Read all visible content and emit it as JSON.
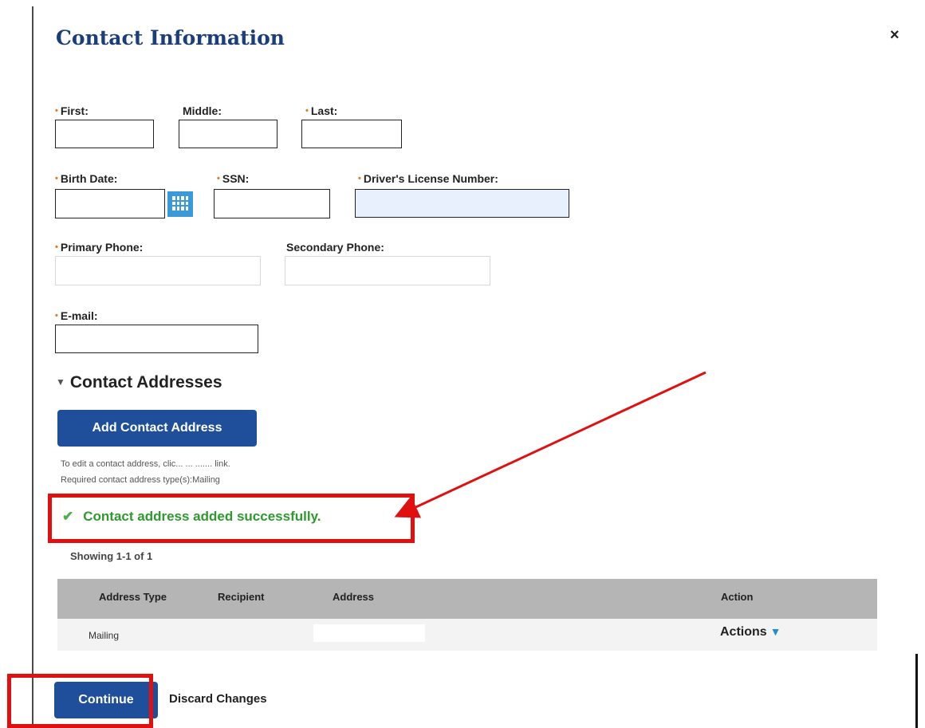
{
  "dialog": {
    "title": "Contact Information",
    "close_label": "×"
  },
  "form": {
    "first_label": "First:",
    "middle_label": "Middle:",
    "last_label": "Last:",
    "birth_date_label": "Birth Date:",
    "ssn_label": "SSN:",
    "drivers_license_label": "Driver's License Number:",
    "primary_phone_label": "Primary Phone:",
    "secondary_phone_label": "Secondary Phone:",
    "email_label": "E-mail:",
    "required_marker": "•"
  },
  "addresses": {
    "section_title": "Contact Addresses",
    "add_button_label": "Add Contact Address",
    "hint_edit": "To edit a contact address, clic... ... ....... link.",
    "hint_required": "Required contact address type(s):Mailing",
    "success_message": "Contact address added successfully.",
    "success_icon": "check-icon",
    "showing_text": "Showing 1-1 of 1",
    "table": {
      "headers": [
        "Address Type",
        "Recipient",
        "Address",
        "Action"
      ],
      "rows": [
        {
          "address_type": "Mailing",
          "recipient": "",
          "address": "",
          "action": "Actions"
        }
      ]
    }
  },
  "footer": {
    "continue_label": "Continue",
    "discard_label": "Discard Changes"
  },
  "colors": {
    "title": "#1a3d7c",
    "primary_button": "#1f4f9a",
    "required": "#e07a1f",
    "success": "#2e9a2e",
    "annotation": "#e01010",
    "table_header": "#b5b5b5"
  }
}
